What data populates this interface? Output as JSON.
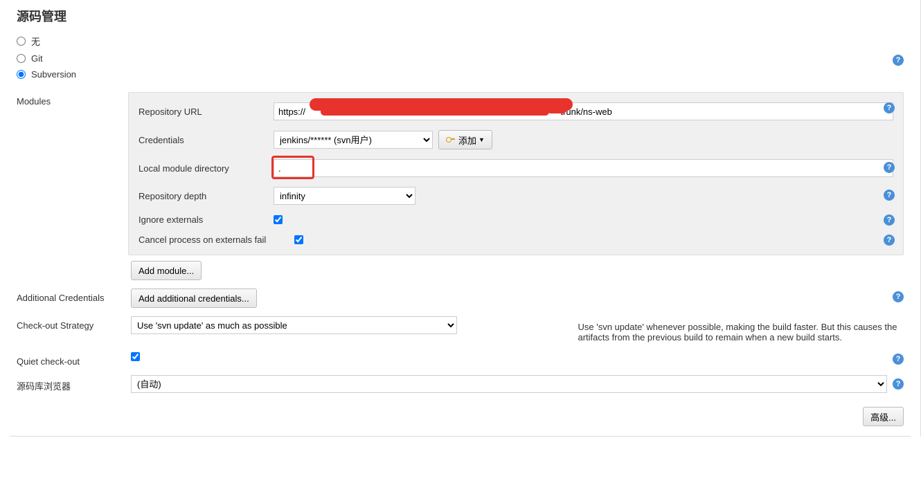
{
  "section_title": "源码管理",
  "scm_options": {
    "none": "无",
    "git": "Git",
    "subversion": "Subversion"
  },
  "modules_label": "Modules",
  "fields": {
    "repo_url_label": "Repository URL",
    "repo_url_value": "https://                                                                                                      trunk/ns-web",
    "credentials_label": "Credentials",
    "credentials_value": "jenkins/****** (svn用户)",
    "add_btn": "添加",
    "local_dir_label": "Local module directory",
    "local_dir_value": ".",
    "repo_depth_label": "Repository depth",
    "repo_depth_value": "infinity",
    "ignore_ext_label": "Ignore externals",
    "cancel_ext_label": "Cancel process on externals fail",
    "add_module_btn": "Add module...",
    "add_cred_label": "Additional Credentials",
    "add_cred_btn": "Add additional credentials...",
    "checkout_label": "Check-out Strategy",
    "checkout_value": "Use 'svn update' as much as possible",
    "checkout_desc": "Use 'svn update' whenever possible, making the build faster. But this causes the artifacts from the previous build to remain when a new build starts.",
    "quiet_label": "Quiet check-out",
    "browser_label": "源码库浏览器",
    "browser_value": "(自动)",
    "advanced_btn": "高级..."
  }
}
